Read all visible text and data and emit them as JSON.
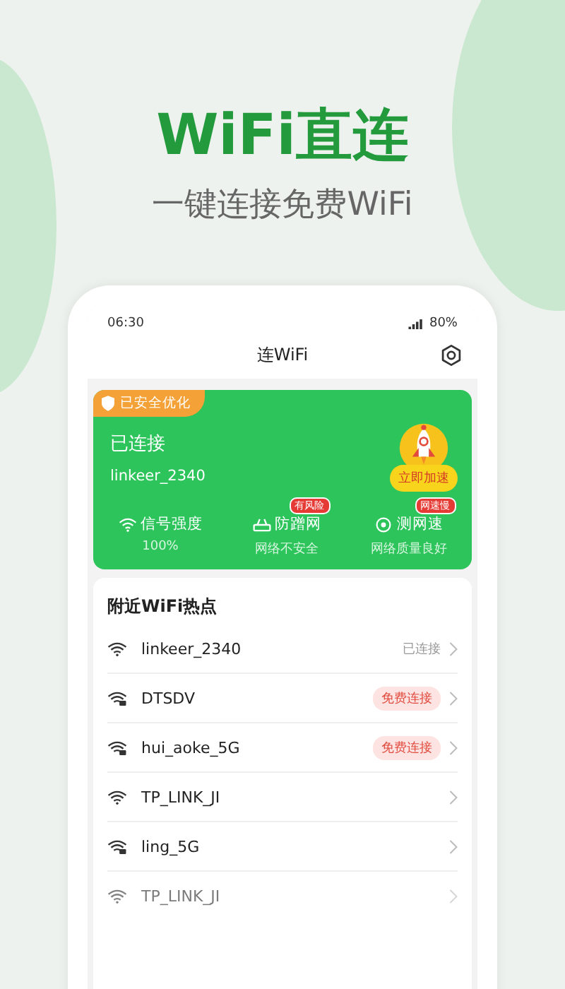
{
  "promo": {
    "title": "WiFi直连",
    "subtitle": "一键连接免费WiFi"
  },
  "status_bar": {
    "time": "06:30",
    "battery": "80%"
  },
  "header": {
    "title": "连WiFi"
  },
  "connection_card": {
    "badge": "已安全优化",
    "status": "已连接",
    "network": "linkeer_2340",
    "boost_button": "立即加速",
    "stats": [
      {
        "kind": "signal",
        "label": "信号强度",
        "value": "100%"
      },
      {
        "kind": "shield",
        "label": "防蹭网",
        "value": "网络不安全",
        "tag": "有风险"
      },
      {
        "kind": "speed",
        "label": "测网速",
        "value": "网络质量良好",
        "tag": "网速慢"
      }
    ]
  },
  "nearby": {
    "heading": "附近WiFi热点",
    "networks": [
      {
        "name": "linkeer_2340",
        "locked": false,
        "kind": "connected",
        "action": "已连接"
      },
      {
        "name": "DTSDV",
        "locked": true,
        "kind": "free",
        "action": "免费连接"
      },
      {
        "name": "hui_aoke_5G",
        "locked": true,
        "kind": "free",
        "action": "免费连接"
      },
      {
        "name": "TP_LINK_JI",
        "locked": false,
        "kind": "none"
      },
      {
        "name": "ling_5G",
        "locked": true,
        "kind": "none"
      },
      {
        "name": "TP_LINK_JI",
        "locked": false,
        "kind": "none"
      }
    ]
  }
}
